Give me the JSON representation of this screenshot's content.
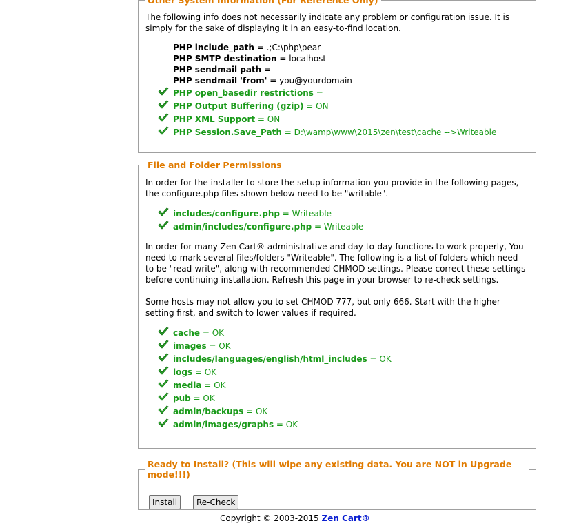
{
  "system_info": {
    "legend": "Other System Information (For Reference Only)",
    "intro": "The following info does not necessarily indicate any problem or configuration issue. It is simply for the sake of displaying it in an easy-to-find location.",
    "plain_items": [
      {
        "label": "PHP include_path",
        "value": " = .;C:\\php\\pear"
      },
      {
        "label": "PHP SMTP destination",
        "value": " = localhost"
      },
      {
        "label": "PHP sendmail path",
        "value": " ="
      },
      {
        "label": "PHP sendmail 'from'",
        "value": " = you@yourdomain"
      }
    ],
    "check_items": [
      {
        "label": "PHP open_basedir restrictions",
        "value": " ="
      },
      {
        "label": "PHP Output Buffering (gzip)",
        "value": " = ON"
      },
      {
        "label": "PHP XML Support",
        "value": " = ON"
      },
      {
        "label": "PHP Session.Save_Path",
        "value": " = D:\\wamp\\www\\2015\\zen\\test\\cache  -->Writeable"
      }
    ]
  },
  "permissions": {
    "legend": "File and Folder Permissions",
    "intro": "In order for the installer to store the setup information you provide in the following pages, the configure.php files shown below need to be \"writable\".",
    "config_items": [
      {
        "label": "includes/configure.php",
        "value": " = Writeable"
      },
      {
        "label": "admin/includes/configure.php",
        "value": " = Writeable"
      }
    ],
    "para1": "In order for many Zen Cart® administrative and day-to-day functions to work properly, You need to mark several files/folders \"Writeable\". The following is a list of folders which need to be \"read-write\", along with recommended CHMOD settings. Please correct these settings before continuing installation. Refresh this page in your browser to re-check settings.",
    "para2": "Some hosts may not allow you to set CHMOD 777, but only 666. Start with the higher setting first, and switch to lower values if required.",
    "folder_items": [
      {
        "label": "cache",
        "value": " = OK"
      },
      {
        "label": "images",
        "value": " = OK"
      },
      {
        "label": "includes/languages/english/html_includes",
        "value": " = OK"
      },
      {
        "label": "logs",
        "value": " = OK"
      },
      {
        "label": "media",
        "value": " = OK"
      },
      {
        "label": "pub",
        "value": " = OK"
      },
      {
        "label": "admin/backups",
        "value": " = OK"
      },
      {
        "label": "admin/images/graphs",
        "value": " = OK"
      }
    ]
  },
  "install": {
    "legend": "Ready to Install? (This will wipe any existing data. You are NOT in Upgrade mode!!!)",
    "install_label": "Install",
    "recheck_label": "Re-Check"
  },
  "footer": {
    "copyright": "Copyright © 2003-2015 ",
    "brand": "Zen Cart®"
  },
  "colors": {
    "legend": "#e07b00",
    "ok_green": "#1a9a1a",
    "brand_link": "#0b1fd1"
  },
  "icons": {
    "check": "green-checkmark-icon"
  }
}
